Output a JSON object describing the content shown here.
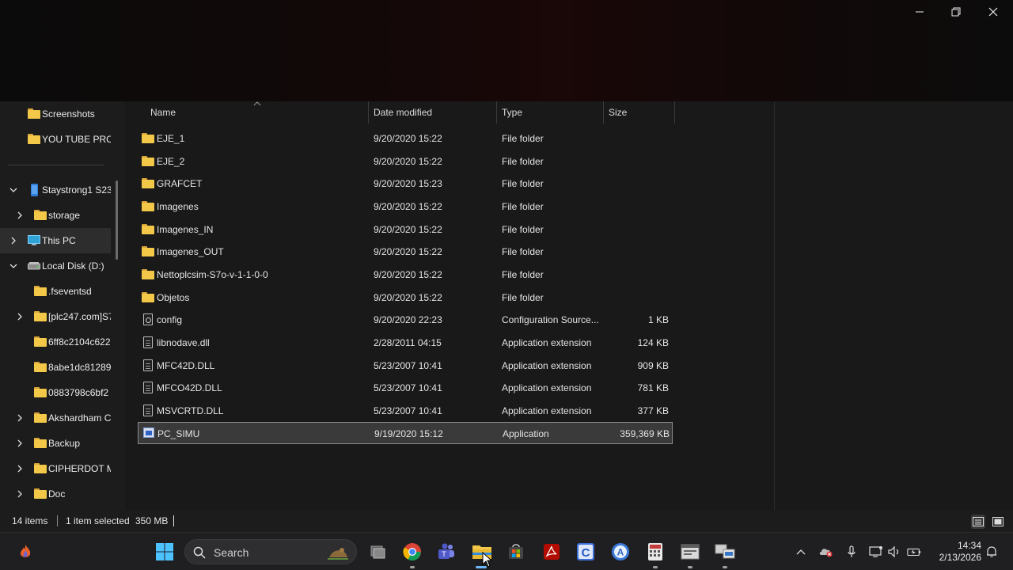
{
  "window": {
    "minimize_icon": "minimize-icon",
    "maximize_icon": "restore-icon",
    "close_icon": "close-icon"
  },
  "nav": {
    "items": [
      {
        "label": "Screenshots",
        "icon": "folder-icon",
        "expandable": false
      },
      {
        "label": "YOU TUBE PROJ",
        "icon": "folder-icon",
        "expandable": false
      },
      {
        "label": "Staystrong1 S23",
        "icon": "phone-icon",
        "expandable": true,
        "expanded": true
      },
      {
        "label": "storage",
        "icon": "folder-icon",
        "expandable": true,
        "expanded": false
      },
      {
        "label": "This PC",
        "icon": "monitor-icon",
        "expandable": true,
        "expanded": false
      },
      {
        "label": "Local Disk (D:)",
        "icon": "drive-icon",
        "expandable": true,
        "expanded": true
      },
      {
        "label": ".fseventsd",
        "icon": "folder-icon",
        "expandable": false
      },
      {
        "label": "[plc247.com]S7",
        "icon": "folder-icon",
        "expandable": true,
        "expanded": false
      },
      {
        "label": "6ff8c2104c622",
        "icon": "folder-icon",
        "expandable": false
      },
      {
        "label": "8abe1dc81289",
        "icon": "folder-icon",
        "expandable": false
      },
      {
        "label": "0883798c6bf2",
        "icon": "folder-icon",
        "expandable": false
      },
      {
        "label": "Akshardham C",
        "icon": "folder-icon",
        "expandable": true,
        "expanded": false
      },
      {
        "label": "Backup",
        "icon": "folder-icon",
        "expandable": true,
        "expanded": false
      },
      {
        "label": "CIPHERDOT M",
        "icon": "folder-icon",
        "expandable": true,
        "expanded": false
      },
      {
        "label": "Doc",
        "icon": "folder-icon",
        "expandable": true,
        "expanded": false
      }
    ]
  },
  "columns": {
    "name": "Name",
    "date": "Date modified",
    "type": "Type",
    "size": "Size"
  },
  "files": [
    {
      "name": "EJE_1",
      "date": "9/20/2020 15:22",
      "type": "File folder",
      "size": "",
      "icon": "folder-icon"
    },
    {
      "name": "EJE_2",
      "date": "9/20/2020 15:22",
      "type": "File folder",
      "size": "",
      "icon": "folder-icon"
    },
    {
      "name": "GRAFCET",
      "date": "9/20/2020 15:23",
      "type": "File folder",
      "size": "",
      "icon": "folder-icon"
    },
    {
      "name": "Imagenes",
      "date": "9/20/2020 15:22",
      "type": "File folder",
      "size": "",
      "icon": "folder-icon"
    },
    {
      "name": "Imagenes_IN",
      "date": "9/20/2020 15:22",
      "type": "File folder",
      "size": "",
      "icon": "folder-icon"
    },
    {
      "name": "Imagenes_OUT",
      "date": "9/20/2020 15:22",
      "type": "File folder",
      "size": "",
      "icon": "folder-icon"
    },
    {
      "name": "Nettoplcsim-S7o-v-1-1-0-0",
      "date": "9/20/2020 15:22",
      "type": "File folder",
      "size": "",
      "icon": "folder-icon"
    },
    {
      "name": "Objetos",
      "date": "9/20/2020 15:22",
      "type": "File folder",
      "size": "",
      "icon": "folder-icon"
    },
    {
      "name": "config",
      "date": "9/20/2020 22:23",
      "type": "Configuration Source...",
      "size": "1 KB",
      "icon": "config-file-icon"
    },
    {
      "name": "libnodave.dll",
      "date": "2/28/2011 04:15",
      "type": "Application extension",
      "size": "124 KB",
      "icon": "dll-file-icon"
    },
    {
      "name": "MFC42D.DLL",
      "date": "5/23/2007 10:41",
      "type": "Application extension",
      "size": "909 KB",
      "icon": "dll-file-icon"
    },
    {
      "name": "MFCO42D.DLL",
      "date": "5/23/2007 10:41",
      "type": "Application extension",
      "size": "781 KB",
      "icon": "dll-file-icon"
    },
    {
      "name": "MSVCRTD.DLL",
      "date": "5/23/2007 10:41",
      "type": "Application extension",
      "size": "377 KB",
      "icon": "dll-file-icon"
    },
    {
      "name": "PC_SIMU",
      "date": "9/19/2020 15:12",
      "type": "Application",
      "size": "359,369 KB",
      "icon": "application-icon",
      "selected": true
    }
  ],
  "status": {
    "item_count": "14 items",
    "selection": "1 item selected",
    "selection_size": "350 MB"
  },
  "taskbar": {
    "search_label": "Search",
    "time": "14:34",
    "date": "2/13/2026",
    "apps": [
      "start-icon",
      "task-view-icon",
      "chrome-icon",
      "teams-icon",
      "file-explorer-icon",
      "store-icon",
      "acrobat-icon",
      "c-app-icon",
      "a-app-icon",
      "calculator-app-icon",
      "window-app-icon",
      "remote-app-icon"
    ]
  }
}
